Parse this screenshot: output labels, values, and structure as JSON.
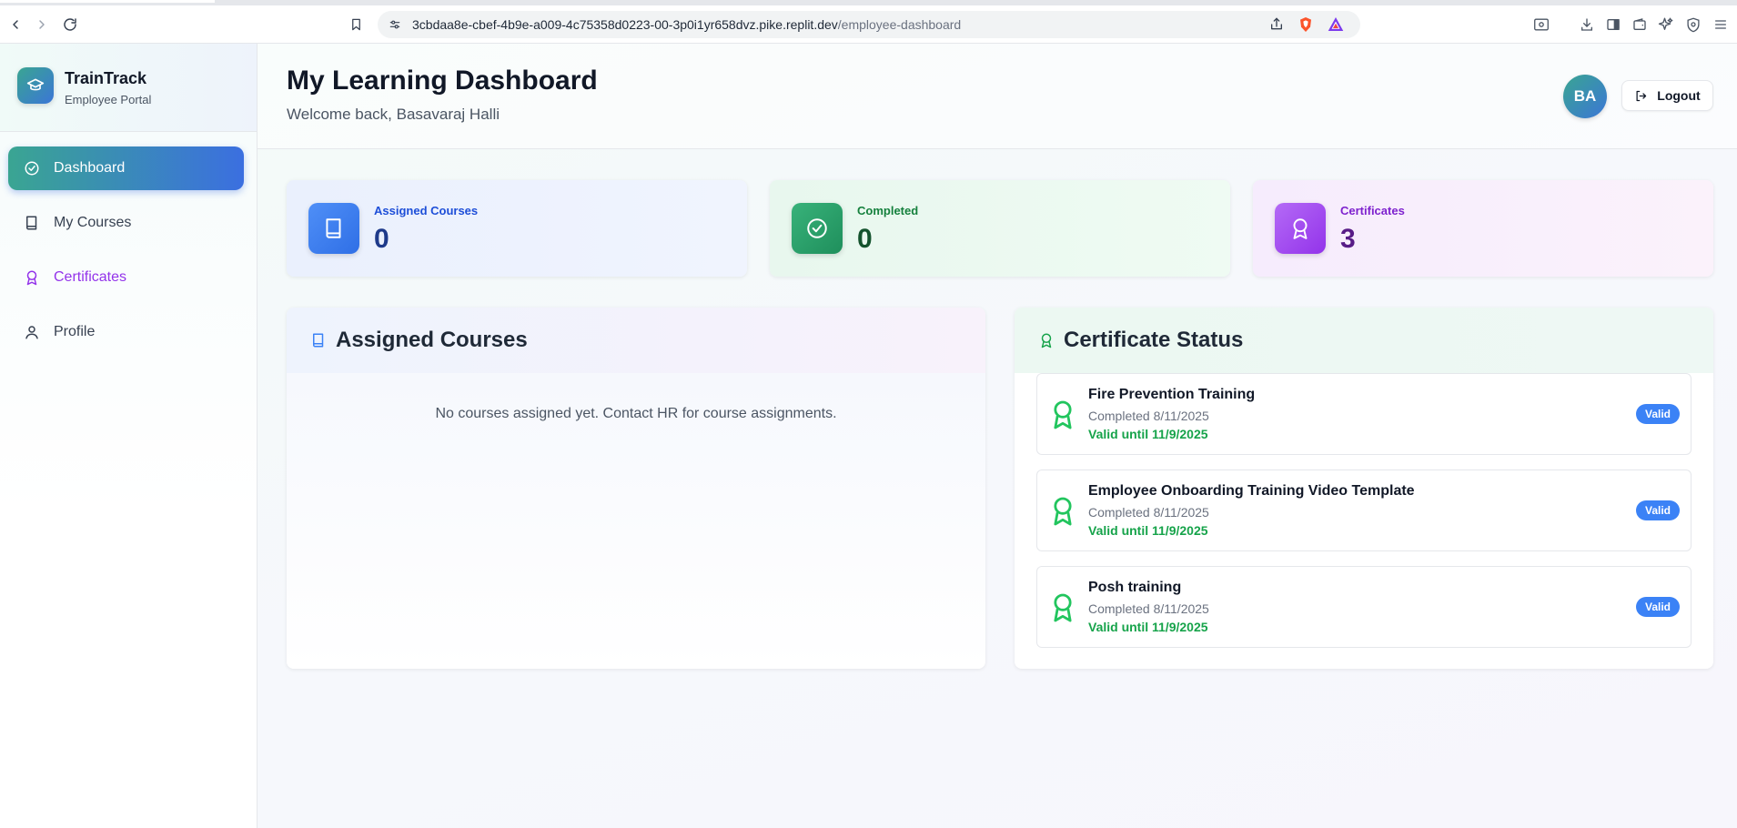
{
  "browser": {
    "url_host": "3cbdaa8e-cbef-4b9e-a009-4c75358d0223-00-3p0i1yr658dvz.pike.replit.dev",
    "url_path": "/employee-dashboard"
  },
  "sidebar": {
    "brand_name": "TrainTrack",
    "brand_sub": "Employee Portal",
    "items": [
      {
        "label": "Dashboard",
        "icon": "circle-check-icon",
        "active": true
      },
      {
        "label": "My Courses",
        "icon": "book-icon",
        "active": false
      },
      {
        "label": "Certificates",
        "icon": "award-icon",
        "active": false
      },
      {
        "label": "Profile",
        "icon": "user-icon",
        "active": false
      }
    ]
  },
  "header": {
    "title": "My Learning Dashboard",
    "welcome": "Welcome back, Basavaraj Halli",
    "avatar_initials": "BA",
    "logout_label": "Logout"
  },
  "stats": [
    {
      "label": "Assigned Courses",
      "value": "0",
      "icon": "book-icon",
      "color": "#3b82f6"
    },
    {
      "label": "Completed",
      "value": "0",
      "icon": "circle-check-icon",
      "color": "#22a06b"
    },
    {
      "label": "Certificates",
      "value": "3",
      "icon": "award-icon",
      "color": "#a855f7"
    }
  ],
  "assigned_courses": {
    "title": "Assigned Courses",
    "empty_message": "No courses assigned yet. Contact HR for course assignments."
  },
  "certificate_status": {
    "title": "Certificate Status",
    "items": [
      {
        "name": "Fire Prevention Training",
        "completed": "Completed 8/11/2025",
        "valid_until": "Valid until 11/9/2025",
        "badge": "Valid"
      },
      {
        "name": "Employee Onboarding Training Video Template",
        "completed": "Completed 8/11/2025",
        "valid_until": "Valid until 11/9/2025",
        "badge": "Valid"
      },
      {
        "name": "Posh training",
        "completed": "Completed 8/11/2025",
        "valid_until": "Valid until 11/9/2025",
        "badge": "Valid"
      }
    ]
  }
}
